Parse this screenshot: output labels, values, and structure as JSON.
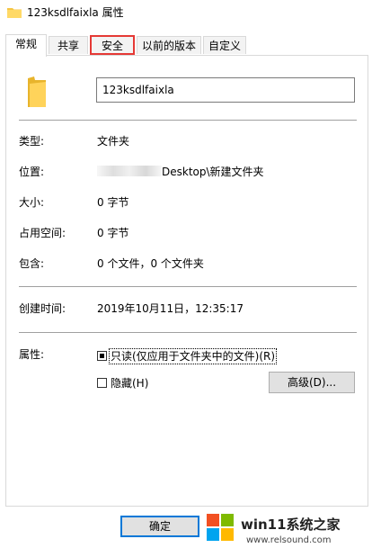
{
  "window": {
    "title": "123ksdlfaixla 属性"
  },
  "tabs": [
    "常规",
    "共享",
    "安全",
    "以前的版本",
    "自定义"
  ],
  "name_field": {
    "value": "123ksdlfaixla"
  },
  "props": {
    "type_label": "类型:",
    "type_value": "文件夹",
    "location_label": "位置:",
    "location_value": "Desktop\\新建文件夹",
    "size_label": "大小:",
    "size_value": "0 字节",
    "disk_label": "占用空间:",
    "disk_value": "0 字节",
    "contains_label": "包含:",
    "contains_value": "0 个文件，0 个文件夹",
    "created_label": "创建时间:",
    "created_value": "2019年10月11日，12:35:17",
    "attr_label": "属性:"
  },
  "attributes": {
    "readonly": "只读(仅应用于文件夹中的文件)(R)",
    "hidden": "隐藏(H)",
    "advanced_button": "高级(D)..."
  },
  "footer": {
    "ok_button": "确定"
  },
  "watermark": {
    "brand": "win11系统之家",
    "url": "www.relsound.com"
  },
  "colors": {
    "highlight": "#e53935",
    "folder": "#f5c543",
    "accent": "#0078d7"
  }
}
